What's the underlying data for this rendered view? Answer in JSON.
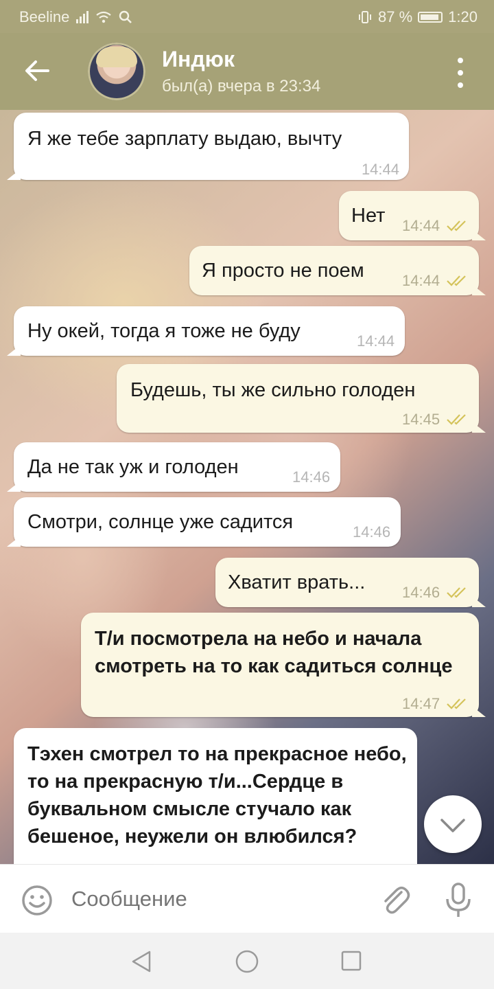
{
  "status_bar": {
    "carrier": "Beeline",
    "battery": "87 %",
    "time": "1:20"
  },
  "header": {
    "contact_name": "Индюк",
    "last_seen": "был(а) вчера в 23:34"
  },
  "messages": [
    {
      "direction": "in",
      "text": "Я же тебе зарплату выдаю, вычту",
      "time": "14:44",
      "read": false
    },
    {
      "direction": "out",
      "text": "Нет",
      "time": "14:44",
      "read": true
    },
    {
      "direction": "out",
      "text": "Я просто не поем",
      "time": "14:44",
      "read": true
    },
    {
      "direction": "in",
      "text": "Ну окей, тогда я тоже не буду",
      "time": "14:44",
      "read": false
    },
    {
      "direction": "out",
      "text": "Будешь, ты же сильно голоден",
      "time": "14:45",
      "read": true
    },
    {
      "direction": "in",
      "text": "Да не так уж и голоден",
      "time": "14:46",
      "read": false
    },
    {
      "direction": "in",
      "text": "Смотри, солнце уже садится",
      "time": "14:46",
      "read": false
    },
    {
      "direction": "out",
      "text": "Хватит врать...",
      "time": "14:46",
      "read": true
    },
    {
      "direction": "out",
      "text": "Т/и посмотрела на небо и начала смотреть на то как садиться солнце",
      "time": "14:47",
      "read": true
    },
    {
      "direction": "in",
      "text": "Тэхен смотрел то на прекрасное небо, то на прекрасную т/и...Сердце в буквальном смысле стучало как бешеное, неужели он влюбился?",
      "time": "",
      "read": false
    }
  ],
  "composer": {
    "placeholder": "Сообщение"
  },
  "colors": {
    "header_bg": "#a6a277",
    "outgoing_bubble": "#fbf7e3",
    "incoming_bubble": "#ffffff",
    "read_check": "#d4c35a"
  },
  "icons": {
    "back": "arrow-left-icon",
    "menu": "more-vert-icon",
    "emoji": "smiley-icon",
    "attach": "paperclip-icon",
    "mic": "microphone-icon",
    "scroll": "chevron-down-icon",
    "nav": [
      "triangle-back-icon",
      "circle-home-icon",
      "square-recents-icon"
    ]
  }
}
